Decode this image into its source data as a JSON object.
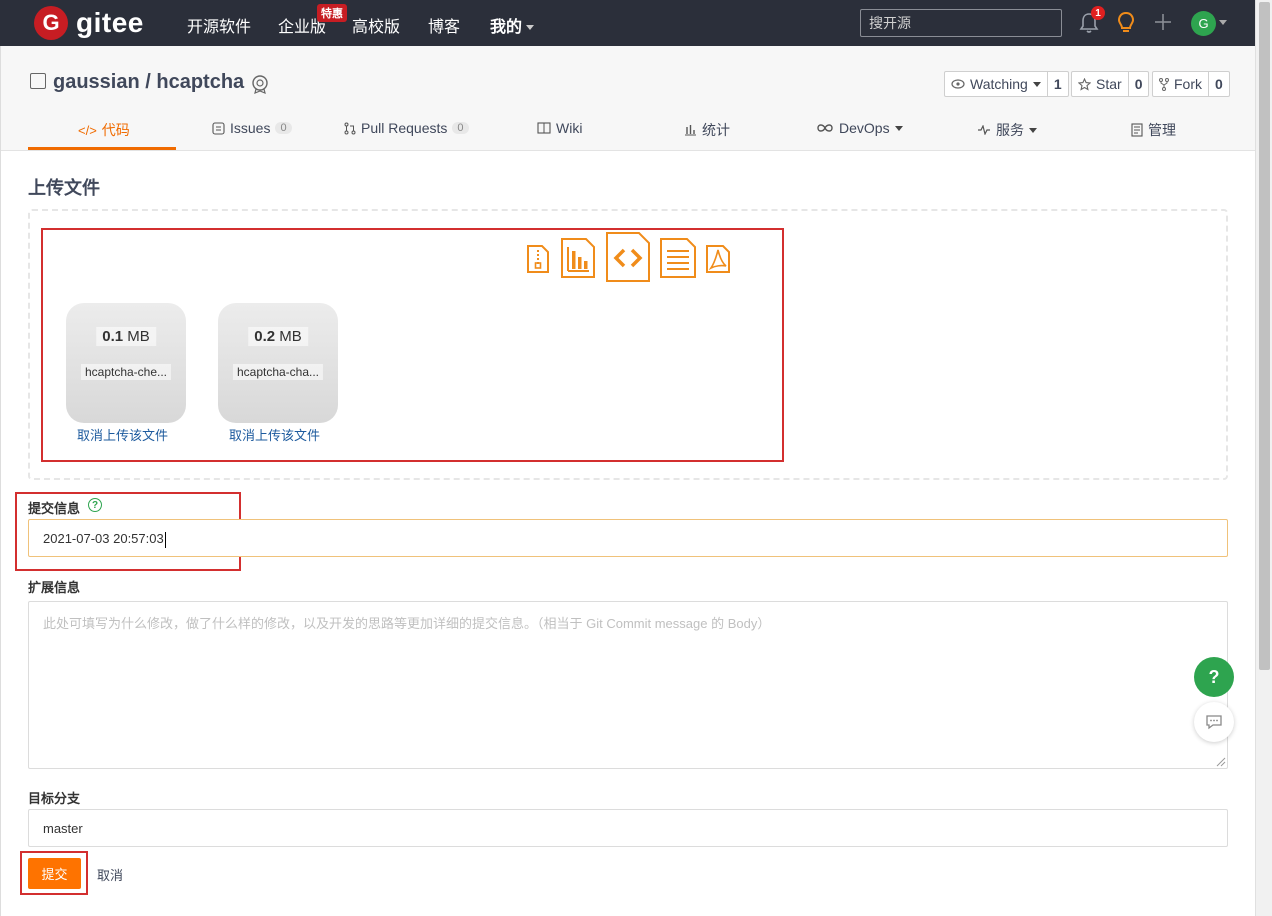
{
  "nav": {
    "logo_letter": "G",
    "logo_text": "gitee",
    "items": [
      "开源软件",
      "企业版",
      "高校版",
      "博客",
      "我的"
    ],
    "badge": "特惠",
    "search_placeholder": "搜开源",
    "notif_count": "1",
    "avatar_letter": "G"
  },
  "repo": {
    "title": "gaussian / hcaptcha",
    "watching_label": "Watching",
    "watching_count": "1",
    "star_label": "Star",
    "star_count": "0",
    "fork_label": "Fork",
    "fork_count": "0"
  },
  "tabs": [
    {
      "label": "代码"
    },
    {
      "label": "Issues",
      "count": "0"
    },
    {
      "label": "Pull Requests",
      "count": "0"
    },
    {
      "label": "Wiki"
    },
    {
      "label": "统计"
    },
    {
      "label": "DevOps"
    },
    {
      "label": "服务"
    },
    {
      "label": "管理"
    }
  ],
  "upload": {
    "title": "上传文件",
    "files": [
      {
        "size_num": "0.1",
        "size_unit": "MB",
        "name": "hcaptcha-che...",
        "cancel": "取消上传该文件"
      },
      {
        "size_num": "0.2",
        "size_unit": "MB",
        "name": "hcaptcha-cha...",
        "cancel": "取消上传该文件"
      }
    ]
  },
  "form": {
    "commit_label": "提交信息",
    "commit_value": "2021-07-03 20:57:03",
    "ext_label": "扩展信息",
    "ext_placeholder": "此处可填写为什么修改，做了什么样的修改，以及开发的思路等更加详细的提交信息。（相当于 Git Commit message 的 Body）",
    "branch_label": "目标分支",
    "branch_value": "master",
    "submit": "提交",
    "cancel": "取消"
  },
  "float": {
    "help": "?"
  },
  "colors": {
    "accent": "#fe7300",
    "nav_bg": "#2b2f3a",
    "brand_red": "#c71d23",
    "annotation_red": "#d32f2f"
  }
}
